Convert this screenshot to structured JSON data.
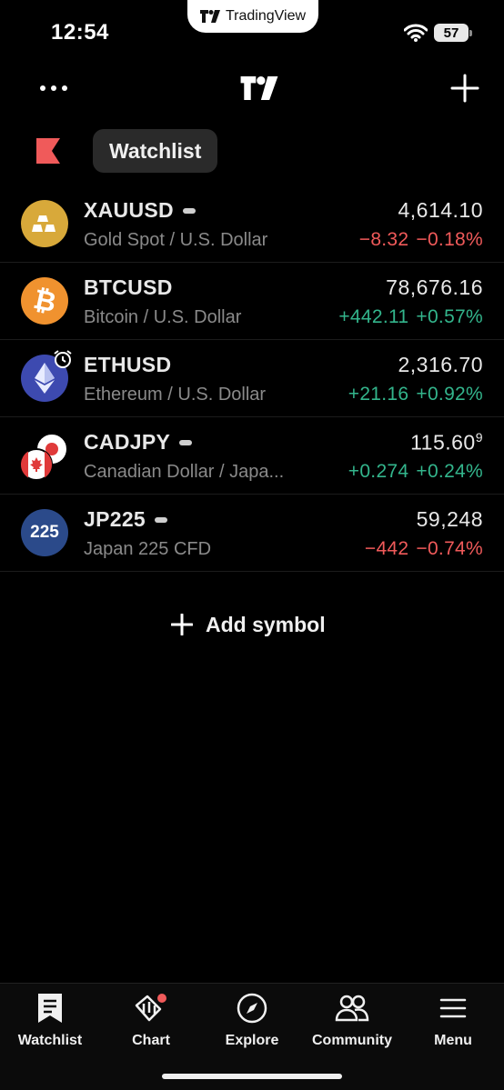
{
  "status_bar": {
    "time": "12:54",
    "island_label": "TradingView",
    "battery": "57",
    "wifi_icon": "wifi-icon"
  },
  "header": {
    "more_icon": "more-dots-icon",
    "logo_icon": "tradingview-logo-icon",
    "add_icon": "plus-icon",
    "flag_icon": "flag-icon",
    "watchlist_label": "Watchlist"
  },
  "watchlist": [
    {
      "symbol": "XAUUSD",
      "description": "Gold Spot / U.S. Dollar",
      "price": "4,614.10",
      "price_sup": "",
      "change": "−8.32",
      "change_pct": "−0.18%",
      "direction": "down",
      "icon": "gold-bars-icon"
    },
    {
      "symbol": "BTCUSD",
      "description": "Bitcoin / U.S. Dollar",
      "price": "78,676.16",
      "price_sup": "",
      "change": "+442.11",
      "change_pct": "+0.57%",
      "direction": "up",
      "icon": "bitcoin-icon"
    },
    {
      "symbol": "ETHUSD",
      "description": "Ethereum / U.S. Dollar",
      "price": "2,316.70",
      "price_sup": "",
      "change": "+21.16",
      "change_pct": "+0.92%",
      "direction": "up",
      "icon": "ethereum-icon"
    },
    {
      "symbol": "CADJPY",
      "description": "Canadian Dollar / Japa...",
      "price": "115.60",
      "price_sup": "9",
      "change": "+0.274",
      "change_pct": "+0.24%",
      "direction": "up",
      "icon": "cad-jpy-flags-icon"
    },
    {
      "symbol": "JP225",
      "description": "Japan 225 CFD",
      "price": "59,248",
      "price_sup": "",
      "change": "−442",
      "change_pct": "−0.74%",
      "direction": "down",
      "icon": "jp225-icon",
      "icon_text": "225"
    }
  ],
  "add_symbol_label": "Add symbol",
  "bottom_nav": [
    {
      "label": "Watchlist",
      "icon": "watchlist-icon"
    },
    {
      "label": "Chart",
      "icon": "chart-icon"
    },
    {
      "label": "Explore",
      "icon": "compass-icon"
    },
    {
      "label": "Community",
      "icon": "community-icon"
    },
    {
      "label": "Menu",
      "icon": "menu-icon"
    }
  ],
  "colors": {
    "negative": "#f05a5a",
    "positive": "#33b58c",
    "gold": "#d8a93a",
    "bitcoin": "#f0922f",
    "ethereum": "#3d4ab0",
    "jp225": "#2b4a8a"
  }
}
